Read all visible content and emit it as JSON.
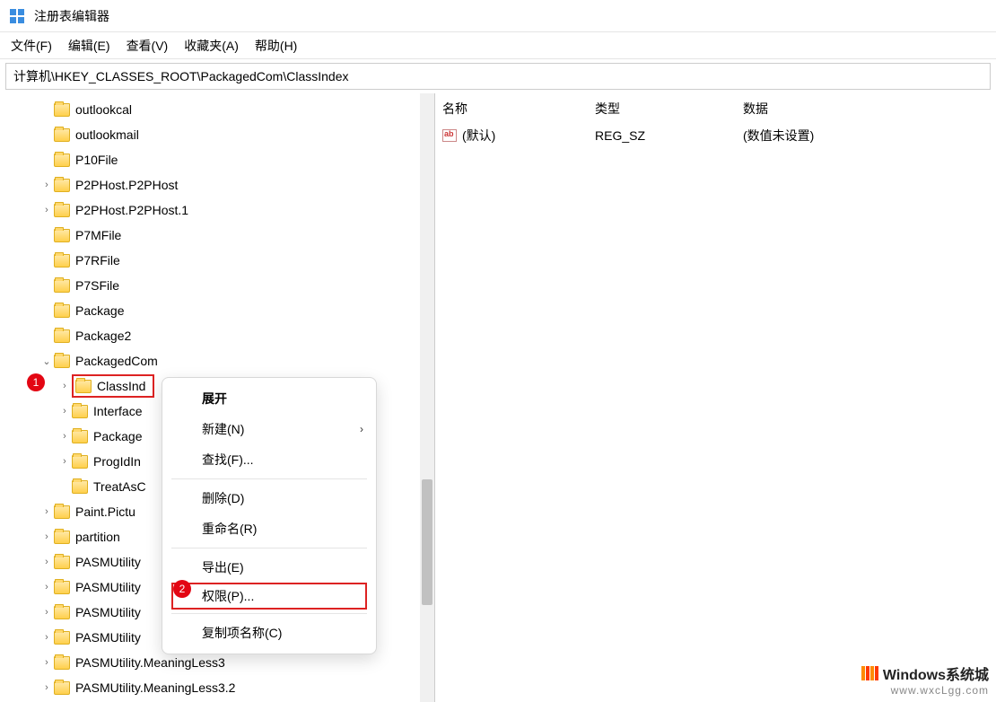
{
  "window": {
    "title": "注册表编辑器"
  },
  "menu": {
    "file": "文件(F)",
    "edit": "编辑(E)",
    "view": "查看(V)",
    "favorites": "收藏夹(A)",
    "help": "帮助(H)"
  },
  "address": "计算机\\HKEY_CLASSES_ROOT\\PackagedCom\\ClassIndex",
  "tree": {
    "items": [
      {
        "label": "outlookcal",
        "depth": 1,
        "exp": null
      },
      {
        "label": "outlookmail",
        "depth": 1,
        "exp": null
      },
      {
        "label": "P10File",
        "depth": 1,
        "exp": null
      },
      {
        "label": "P2PHost.P2PHost",
        "depth": 1,
        "exp": "closed"
      },
      {
        "label": "P2PHost.P2PHost.1",
        "depth": 1,
        "exp": "closed"
      },
      {
        "label": "P7MFile",
        "depth": 1,
        "exp": null
      },
      {
        "label": "P7RFile",
        "depth": 1,
        "exp": null
      },
      {
        "label": "P7SFile",
        "depth": 1,
        "exp": null
      },
      {
        "label": "Package",
        "depth": 1,
        "exp": null
      },
      {
        "label": "Package2",
        "depth": 1,
        "exp": null
      },
      {
        "label": "PackagedCom",
        "depth": 1,
        "exp": "open"
      },
      {
        "label": "ClassInd",
        "depth": 2,
        "exp": "closed",
        "selected": true
      },
      {
        "label": "Interface",
        "depth": 2,
        "exp": "closed",
        "truncated": true
      },
      {
        "label": "Package",
        "depth": 2,
        "exp": "closed",
        "truncated": true
      },
      {
        "label": "ProgIdIn",
        "depth": 2,
        "exp": "closed",
        "truncated": true
      },
      {
        "label": "TreatAsC",
        "depth": 2,
        "exp": null,
        "truncated": true
      },
      {
        "label": "Paint.Pictu",
        "depth": 1,
        "exp": "closed",
        "truncated": true
      },
      {
        "label": "partition",
        "depth": 1,
        "exp": "closed"
      },
      {
        "label": "PASMUtility",
        "depth": 1,
        "exp": "closed",
        "truncated": true
      },
      {
        "label": "PASMUtility",
        "depth": 1,
        "exp": "closed",
        "truncated": true
      },
      {
        "label": "PASMUtility",
        "depth": 1,
        "exp": "closed",
        "truncated": true
      },
      {
        "label": "PASMUtility",
        "depth": 1,
        "exp": "closed",
        "truncated": true
      },
      {
        "label": "PASMUtility.MeaningLess3",
        "depth": 1,
        "exp": "closed"
      },
      {
        "label": "PASMUtility.MeaningLess3.2",
        "depth": 1,
        "exp": "closed"
      }
    ]
  },
  "context_menu": {
    "expand": "展开",
    "new": "新建(N)",
    "find": "查找(F)...",
    "delete": "删除(D)",
    "rename": "重命名(R)",
    "export": "导出(E)",
    "permissions": "权限(P)...",
    "copy_key_name": "复制项名称(C)"
  },
  "values": {
    "header": {
      "name": "名称",
      "type": "类型",
      "data": "数据"
    },
    "rows": [
      {
        "name": "(默认)",
        "type": "REG_SZ",
        "data": "(数值未设置)"
      }
    ]
  },
  "badges": {
    "one": "1",
    "two": "2"
  },
  "watermark": {
    "title": "Windows系统城",
    "url": "www.wxcLgg.com"
  }
}
